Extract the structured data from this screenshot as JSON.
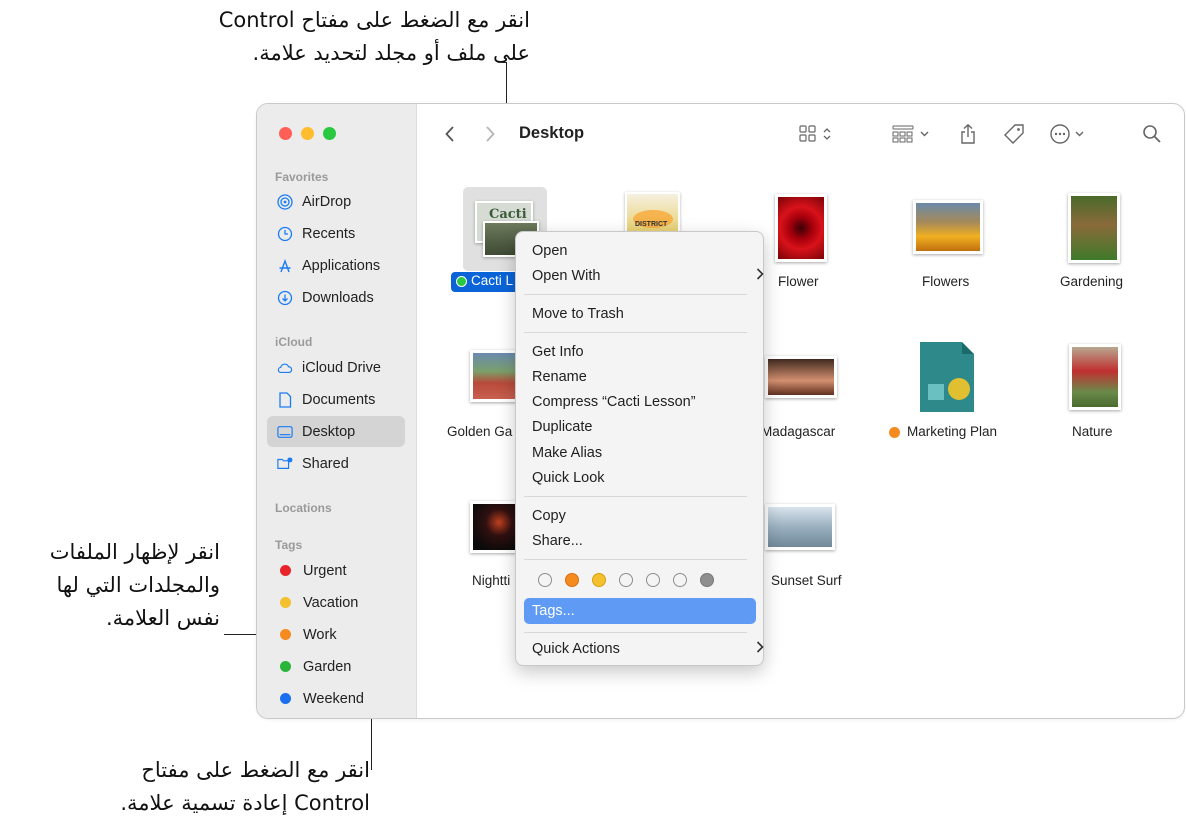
{
  "callouts": {
    "top_line1": "انقر مع الضغط على مفتاح Control",
    "top_line2": "على ملف أو مجلد لتحديد علامة.",
    "left_line1": "انقر لإظهار الملفات",
    "left_line2": "والمجلدات التي لها",
    "left_line3": "نفس العلامة.",
    "bottom_line1": "انقر مع الضغط على مفتاح",
    "bottom_line2": "Control إعادة تسمية علامة."
  },
  "window": {
    "title": "Desktop"
  },
  "sidebar": {
    "favorites_header": "Favorites",
    "favorites": [
      {
        "label": "AirDrop",
        "icon": "airdrop-icon"
      },
      {
        "label": "Recents",
        "icon": "clock-icon"
      },
      {
        "label": "Applications",
        "icon": "applications-icon"
      },
      {
        "label": "Downloads",
        "icon": "download-icon"
      }
    ],
    "icloud_header": "iCloud",
    "icloud": [
      {
        "label": "iCloud Drive",
        "icon": "cloud-icon"
      },
      {
        "label": "Documents",
        "icon": "document-icon"
      },
      {
        "label": "Desktop",
        "icon": "desktop-icon",
        "selected": true
      },
      {
        "label": "Shared",
        "icon": "shared-folder-icon"
      }
    ],
    "locations_header": "Locations",
    "tags_header": "Tags",
    "tags": [
      {
        "label": "Urgent",
        "color": "#e8242b"
      },
      {
        "label": "Vacation",
        "color": "#f5c02e"
      },
      {
        "label": "Work",
        "color": "#f58a1f"
      },
      {
        "label": "Garden",
        "color": "#2bb43a"
      },
      {
        "label": "Weekend",
        "color": "#1a6ff0"
      }
    ]
  },
  "toolbar": {
    "back_icon": "chevron-left-icon",
    "forward_icon": "chevron-right-icon",
    "view_icon": "grid-view-icon",
    "group_icon": "group-icon",
    "share_icon": "share-icon",
    "tag_icon": "tag-icon",
    "more_icon": "ellipsis-circle-icon",
    "search_icon": "search-icon"
  },
  "files": {
    "selected": "Cacti L",
    "thumb_cacti_text": "Cacti",
    "thumb_district_text": "DISTRICT",
    "flower": "Flower",
    "flowers": "Flowers",
    "gardening": "Gardening",
    "golden_gate": "Golden Ga",
    "madagascar": "Madagascar",
    "marketing_plan": "Marketing Plan",
    "marketing_tag_color": "#f58a1f",
    "nature": "Nature",
    "nighttime": "Nightti",
    "sunset_surf": "Sunset Surf"
  },
  "menu": {
    "open": "Open",
    "open_with": "Open With",
    "move_to_trash": "Move to Trash",
    "get_info": "Get Info",
    "rename": "Rename",
    "compress": "Compress “Cacti Lesson”",
    "duplicate": "Duplicate",
    "make_alias": "Make Alias",
    "quick_look": "Quick Look",
    "copy": "Copy",
    "share": "Share...",
    "tags": "Tags...",
    "quick_actions": "Quick Actions",
    "tag_colors": [
      "transparent",
      "#f58a1f",
      "#f5c02e",
      "transparent",
      "transparent",
      "transparent",
      "#8e8e8e"
    ]
  }
}
